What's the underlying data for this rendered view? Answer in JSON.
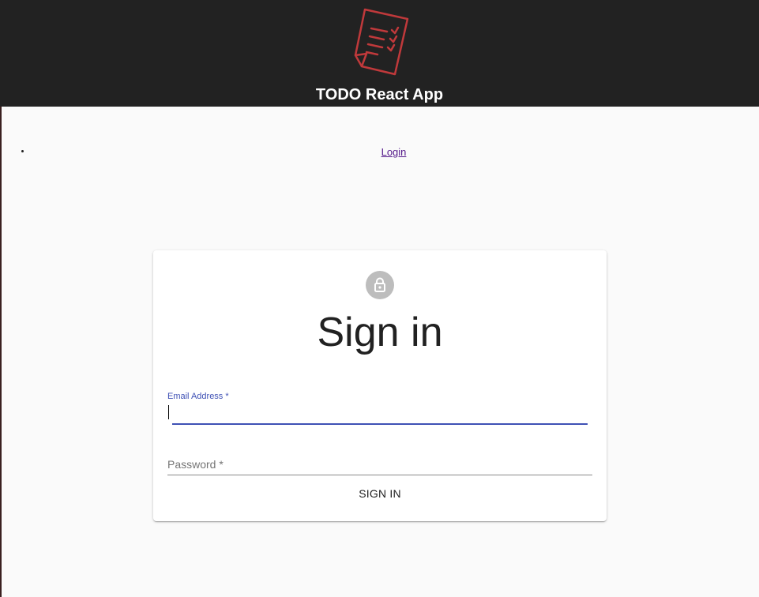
{
  "header": {
    "app_title": "TODO React App",
    "logo_icon": "todo-list-document-icon",
    "logo_color": "#c0393b"
  },
  "nav": {
    "items": [
      {
        "label": "Login"
      }
    ]
  },
  "signin_form": {
    "avatar_icon": "lock-icon",
    "title": "Sign in",
    "email_label": "Email Address *",
    "email_value": "",
    "password_label": "Password *",
    "password_value": "",
    "submit_label": "SIGN IN",
    "accent_color": "#3f51b5"
  }
}
